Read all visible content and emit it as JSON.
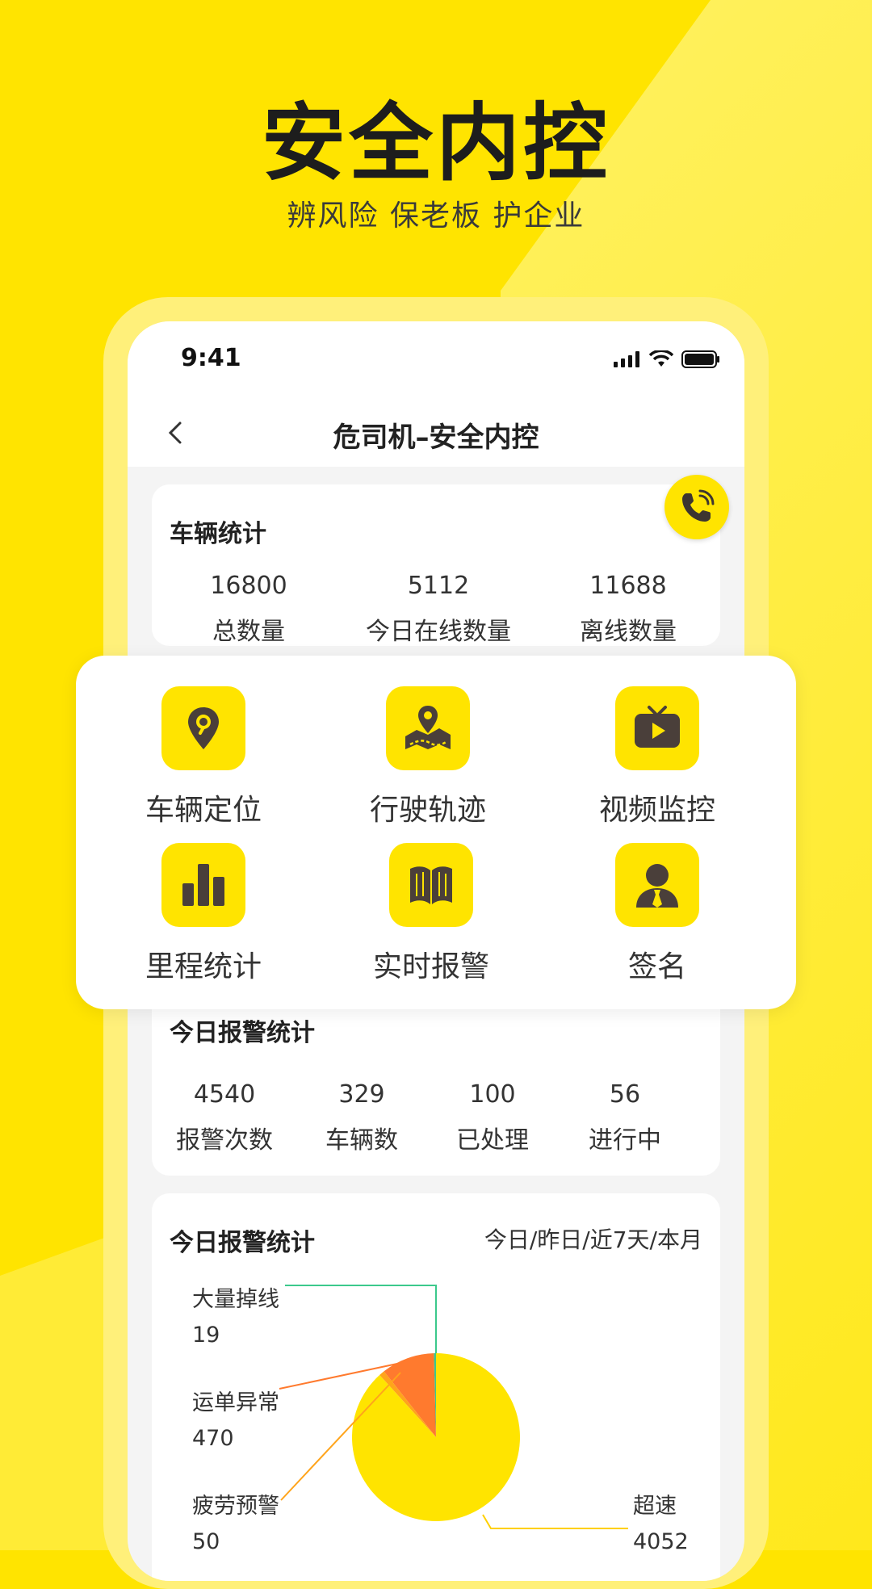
{
  "hero": {
    "title": "安全内控",
    "subtitle": "辨风险 保老板 护企业"
  },
  "status_bar": {
    "time": "9:41",
    "icons": [
      "signal-icon",
      "wifi-icon",
      "battery-icon"
    ]
  },
  "nav": {
    "title": "危司机–安全内控",
    "back_icon": "chevron-left-icon"
  },
  "vehicle_stats": {
    "title": "车辆统计",
    "items": [
      {
        "value": "16800",
        "label": "总数量"
      },
      {
        "value": "5112",
        "label": "今日在线数量"
      },
      {
        "value": "11688",
        "label": "离线数量"
      }
    ],
    "call_icon": "phone-call-icon"
  },
  "menu": {
    "items": [
      {
        "label": "车辆定位",
        "icon": "location-pin-icon"
      },
      {
        "label": "行驶轨迹",
        "icon": "map-track-icon"
      },
      {
        "label": "视频监控",
        "icon": "tv-play-icon"
      },
      {
        "label": "里程统计",
        "icon": "bar-chart-icon"
      },
      {
        "label": "实时报警",
        "icon": "book-icon"
      },
      {
        "label": "签名",
        "icon": "person-icon"
      }
    ]
  },
  "alarm_stats": {
    "title": "今日报警统计",
    "items": [
      {
        "value": "4540",
        "label": "报警次数"
      },
      {
        "value": "329",
        "label": "车辆数"
      },
      {
        "value": "100",
        "label": "已处理"
      },
      {
        "value": "56",
        "label": "进行中"
      }
    ]
  },
  "alarm_chart_card": {
    "title": "今日报警统计",
    "range": "今日/昨日/近7天/本月"
  },
  "colors": {
    "brand_yellow": "#FFE400",
    "dark_icon": "#4A3F3A",
    "orange": "#FF7A2E",
    "green": "#3CC98C",
    "amber": "#FFA41B"
  },
  "chart_data": {
    "type": "pie",
    "categories": [
      "大量掉线",
      "运单异常",
      "疲劳预警",
      "超速"
    ],
    "values": [
      19,
      470,
      50,
      4052
    ],
    "value_labels": [
      "19",
      "470",
      "50",
      "4052"
    ],
    "colors": [
      "#3CC98C",
      "#FF7A2E",
      "#FFA41B",
      "#FFE400"
    ]
  }
}
